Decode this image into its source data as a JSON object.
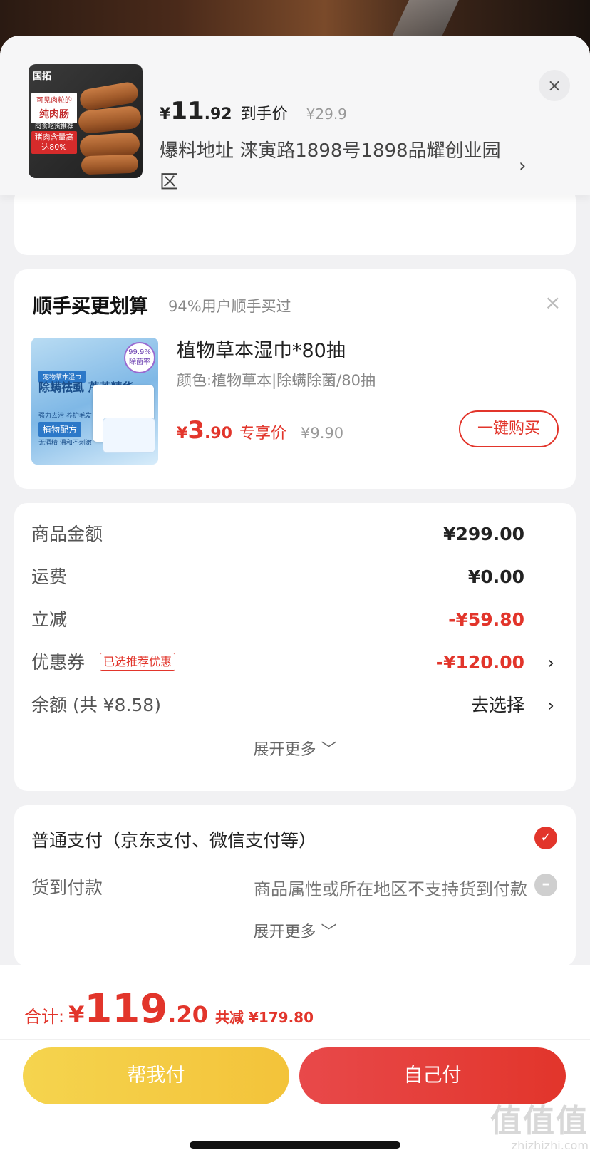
{
  "header": {
    "thumb": {
      "brand": "国拓",
      "tag1": "可见肉粒的",
      "tag2": "纯肉肠",
      "tag3": "肉食吃货推荐",
      "tag4": "猪肉含量高达80%"
    },
    "price_yen": "¥",
    "price_int": "11",
    "price_dec": ".92",
    "price_label": "到手价",
    "price_orig": "¥29.9",
    "address": "爆料地址  涞寅路1898号1898品耀创业园区",
    "address_arrow": "›",
    "close": "×"
  },
  "addon": {
    "title": "顺手买更划算",
    "subtitle": "94%用户顺手买过",
    "close": "×",
    "image": {
      "badge": "99.9% 除菌率",
      "label_a": "宠物草本湿巾",
      "label_b": "除螨祛虱 芦荟精华",
      "label_c": "强力去污 养护毛发",
      "label_d": "植物配方",
      "label_e": "无酒精 温和不刺激"
    },
    "name": "植物草本湿巾*80抽",
    "spec": "颜色:植物草本|除螨除菌/80抽",
    "price_yen": "¥",
    "price_int": "3",
    "price_dec": ".90",
    "price_label": "专享价",
    "price_orig": "¥9.90",
    "buy_label": "一键购买"
  },
  "summary": {
    "rows": [
      {
        "label": "商品金额",
        "value": "¥299.00"
      },
      {
        "label": "运费",
        "value": "¥0.00"
      },
      {
        "label": "立减",
        "value": "-¥59.80"
      },
      {
        "label": "优惠券",
        "value": "-¥120.00",
        "tag": "已选推荐优惠",
        "arrow": "›"
      },
      {
        "label": "余额 (共 ¥8.58)",
        "value": "去选择",
        "arrow": "›"
      }
    ],
    "expand": "展开更多 ﹀"
  },
  "payment": {
    "main": "普通支付（京东支付、微信支付等）",
    "check": "✓",
    "cod": "货到付款",
    "cod_note": "商品属性或所在地区不支持货到付款",
    "disabled": "–",
    "expand": "展开更多 ﹀"
  },
  "footer": {
    "total_label": "合计:",
    "total_yen": "¥",
    "total_int": "119",
    "total_dec": ".20",
    "total_save": "共减 ¥179.80",
    "help_pay": "帮我付",
    "self_pay": "自己付",
    "watermark": "值值值",
    "watermark_url": "zhizhizhi.com"
  },
  "colors": {
    "accent_red": "#e2352b",
    "help_yellow": "#f3c33a"
  }
}
